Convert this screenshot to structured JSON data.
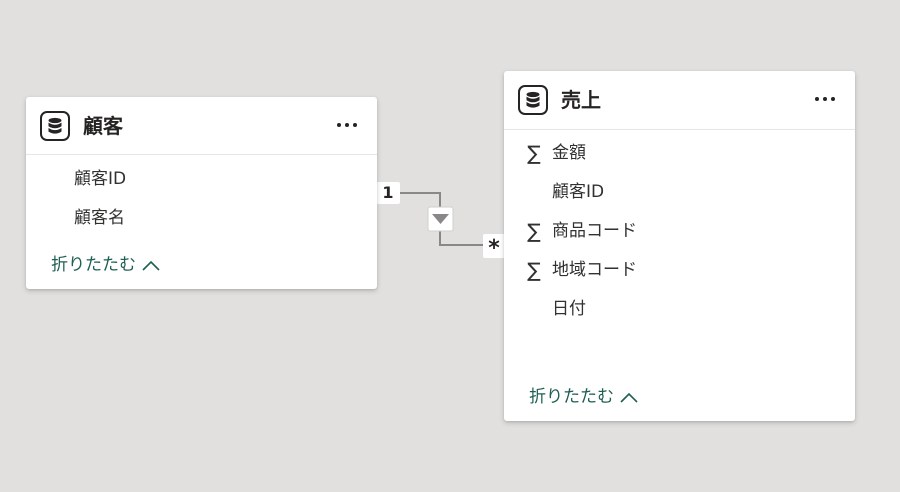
{
  "tables": [
    {
      "name": "顧客",
      "fields": [
        {
          "label": "顧客ID",
          "type": "text"
        },
        {
          "label": "顧客名",
          "type": "text"
        }
      ],
      "collapse_label": "折りたたむ"
    },
    {
      "name": "売上",
      "fields": [
        {
          "label": "金額",
          "type": "sum",
          "symbol": "∑"
        },
        {
          "label": "顧客ID",
          "type": "text"
        },
        {
          "label": "商品コード",
          "type": "sum",
          "symbol": "∑"
        },
        {
          "label": "地域コード",
          "type": "sum",
          "symbol": "∑"
        },
        {
          "label": "日付",
          "type": "text"
        }
      ],
      "collapse_label": "折りたたむ"
    }
  ],
  "relationship": {
    "from_cardinality": "1",
    "to_cardinality": "*",
    "filter_direction": "single",
    "line_color": "#8a8886"
  },
  "colors": {
    "canvas": "#e1e0df",
    "card": "#ffffff",
    "link": "#1f5e52",
    "text": "#252423"
  }
}
